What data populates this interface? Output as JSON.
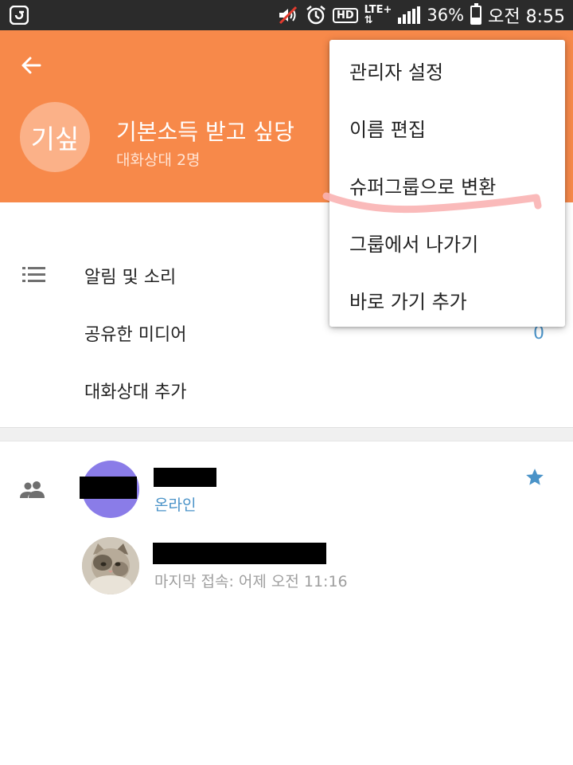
{
  "status_bar": {
    "hd": "HD",
    "lte": "LTE",
    "lte_plus": "+",
    "battery": "36%",
    "time": "오전 8:55",
    "battery_level": 0.36,
    "icons": [
      "app-logo-icon",
      "mute-icon",
      "alarm-icon",
      "signal-icon",
      "battery-icon"
    ]
  },
  "header": {
    "avatar_text": "기싶",
    "title": "기본소득 받고 싶당",
    "subtitle": "대화상대 2명",
    "color": "#f7894a"
  },
  "settings": {
    "notifications": "알림 및 소리",
    "shared_media": "공유한 미디어",
    "shared_media_count": "0",
    "add_member": "대화상대 추가"
  },
  "members": [
    {
      "status": "온라인",
      "status_color": "#4a93c8",
      "starred": true
    },
    {
      "status": "마지막 접속: 어제 오전 11:16",
      "status_color": "#9e9e9e",
      "starred": false
    }
  ],
  "menu": {
    "items": [
      "관리자 설정",
      "이름 편집",
      "슈퍼그룹으로 변환",
      "그룹에서 나가기",
      "바로 가기 추가"
    ],
    "highlight_color": "#f9b2b2"
  }
}
